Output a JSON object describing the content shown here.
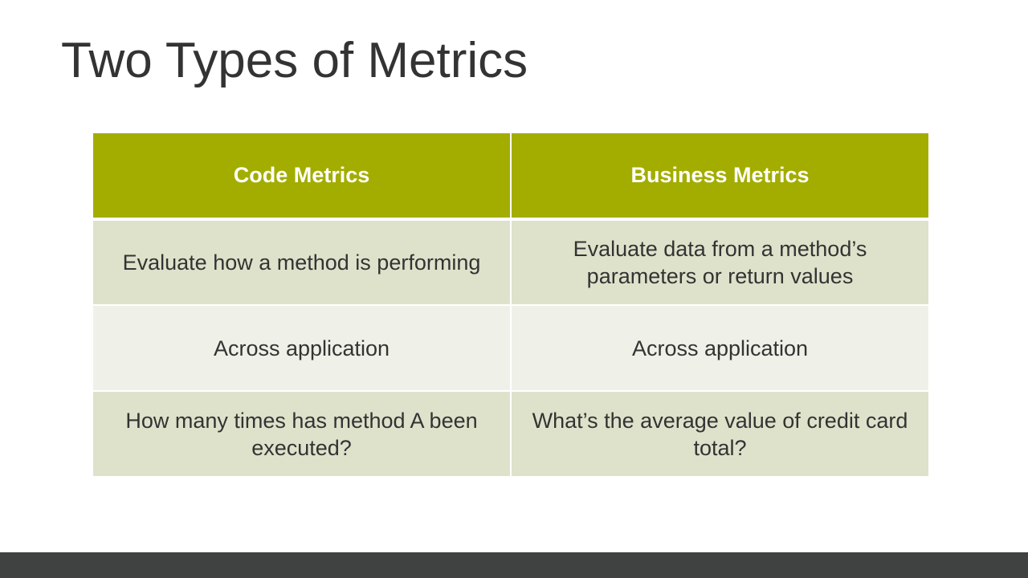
{
  "slide": {
    "title": "Two Types of Metrics"
  },
  "table": {
    "headers": [
      "Code Metrics",
      "Business Metrics"
    ],
    "rows": [
      [
        "Evaluate how a method is performing",
        "Evaluate data from a method’s parameters or return values"
      ],
      [
        "Across application",
        "Across application"
      ],
      [
        "How many times has method A been executed?",
        "What’s the average value of  credit card total?"
      ]
    ]
  },
  "colors": {
    "header_background": "#a3ad00",
    "row_band_dark": "#dfe2cb",
    "row_band_light": "#eff0e7",
    "title_text": "#333333",
    "footer_bar": "#404141"
  }
}
